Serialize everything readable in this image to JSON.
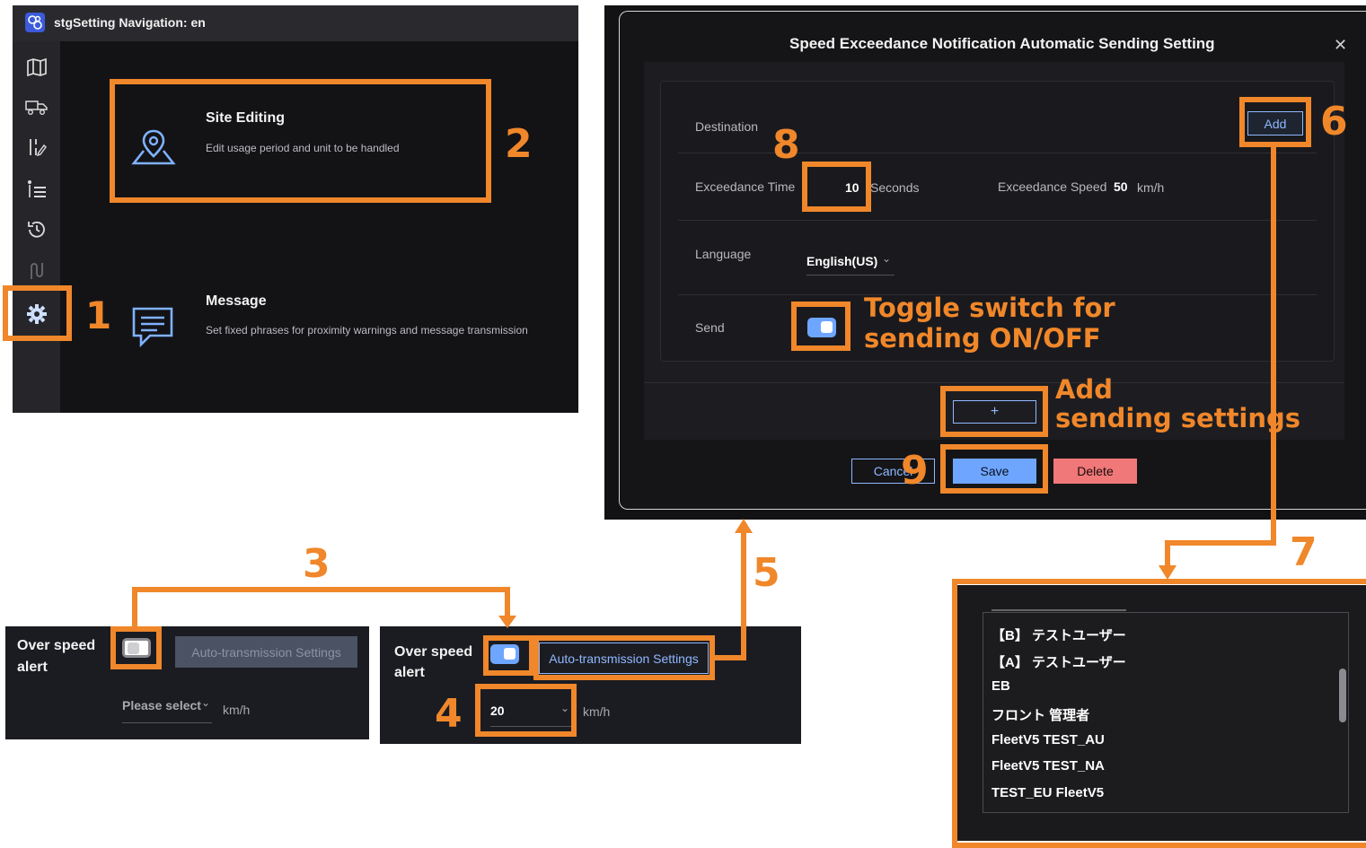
{
  "colors": {
    "accent_orange": "#f0872a",
    "brand_blue": "#6ea6ff",
    "delete_red": "#f07878"
  },
  "nav_panel": {
    "title": "stgSetting Navigation: en",
    "sidebar_icons": [
      "map-icon",
      "truck-icon",
      "route-edit-icon",
      "list-icon",
      "history-icon",
      "path-icon",
      "gear-icon"
    ],
    "items": [
      {
        "title": "Site Editing",
        "description": "Edit usage period and unit to be handled",
        "icon": "map-pin-icon"
      },
      {
        "title": "Message",
        "description": "Set fixed phrases for proximity warnings and message transmission",
        "icon": "chat-icon"
      }
    ]
  },
  "modal": {
    "title": "Speed Exceedance Notification Automatic Sending Setting",
    "close_glyph": "✕",
    "destination_label": "Destination",
    "add_button": "Add",
    "exceedance_time_label": "Exceedance Time",
    "exceedance_time_value": "10",
    "seconds_unit": "Seconds",
    "exceedance_speed_label": "Exceedance Speed",
    "exceedance_speed_value": "50",
    "speed_unit": "km/h",
    "language_label": "Language",
    "language_value": "English(US)",
    "send_label": "Send",
    "send_on": true,
    "add_setting_button": "+",
    "cancel_button": "Cancel",
    "save_button": "Save",
    "delete_button": "Delete"
  },
  "alert_off": {
    "label_line1": "Over speed",
    "label_line2": "alert",
    "toggle_on": false,
    "auto_button": "Auto-transmission Settings",
    "select_placeholder": "Please select",
    "unit": "km/h"
  },
  "alert_on": {
    "label_line1": "Over speed",
    "label_line2": "alert",
    "toggle_on": true,
    "auto_button": "Auto-transmission Settings",
    "select_value": "20",
    "unit": "km/h"
  },
  "destination_list": [
    "【B】 テストユーザー",
    "【A】 テストユーザー",
    "EB",
    "フロント 管理者",
    "FleetV5 TEST_AU",
    "FleetV5 TEST_NA",
    "TEST_EU FleetV5"
  ],
  "annotations": {
    "n1": "1",
    "n2": "2",
    "n3": "3",
    "n4": "4",
    "n5": "5",
    "n6": "6",
    "n7": "7",
    "n8": "8",
    "n9": "9",
    "toggle_note_line1": "Toggle switch for",
    "toggle_note_line2": "sending ON/OFF",
    "add_note_line1": "Add",
    "add_note_line2": "sending settings"
  }
}
